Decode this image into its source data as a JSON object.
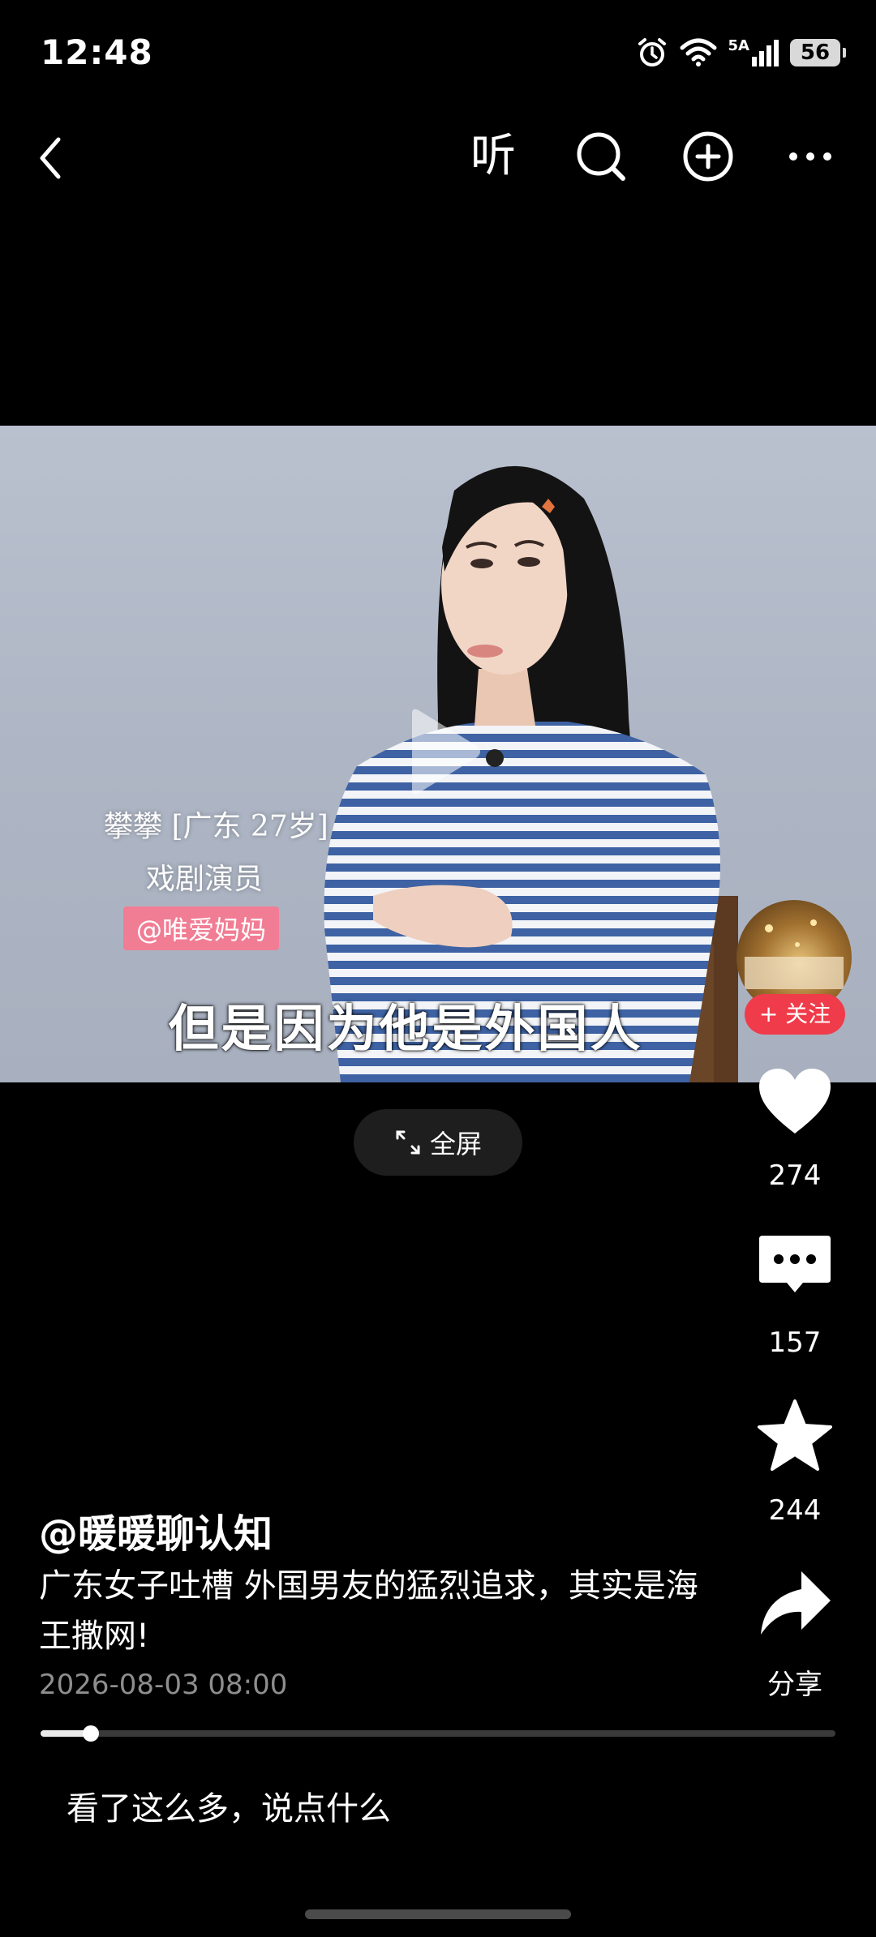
{
  "status_bar": {
    "time": "12:48",
    "network": "5A",
    "battery": "56"
  },
  "nav": {
    "listen_label": "听"
  },
  "video": {
    "caption_name": "攀攀 [广东 27岁]",
    "caption_role": "戏剧演员",
    "caption_handle": "@唯爱妈妈",
    "subtitle": "但是因为他是外国人"
  },
  "rail": {
    "follow_label": "+ 关注",
    "likes": "274",
    "comments": "157",
    "favorites": "244",
    "share_label": "分享"
  },
  "fullscreen_label": "全屏",
  "post": {
    "author": "@暖暖聊认知",
    "description": "广东女子吐槽 外国男友的猛烈追求，其实是海王撒网!",
    "date": "2026-08-03 08:00",
    "progress": 0.063
  },
  "comment_placeholder": "看了这么多，说点什么"
}
